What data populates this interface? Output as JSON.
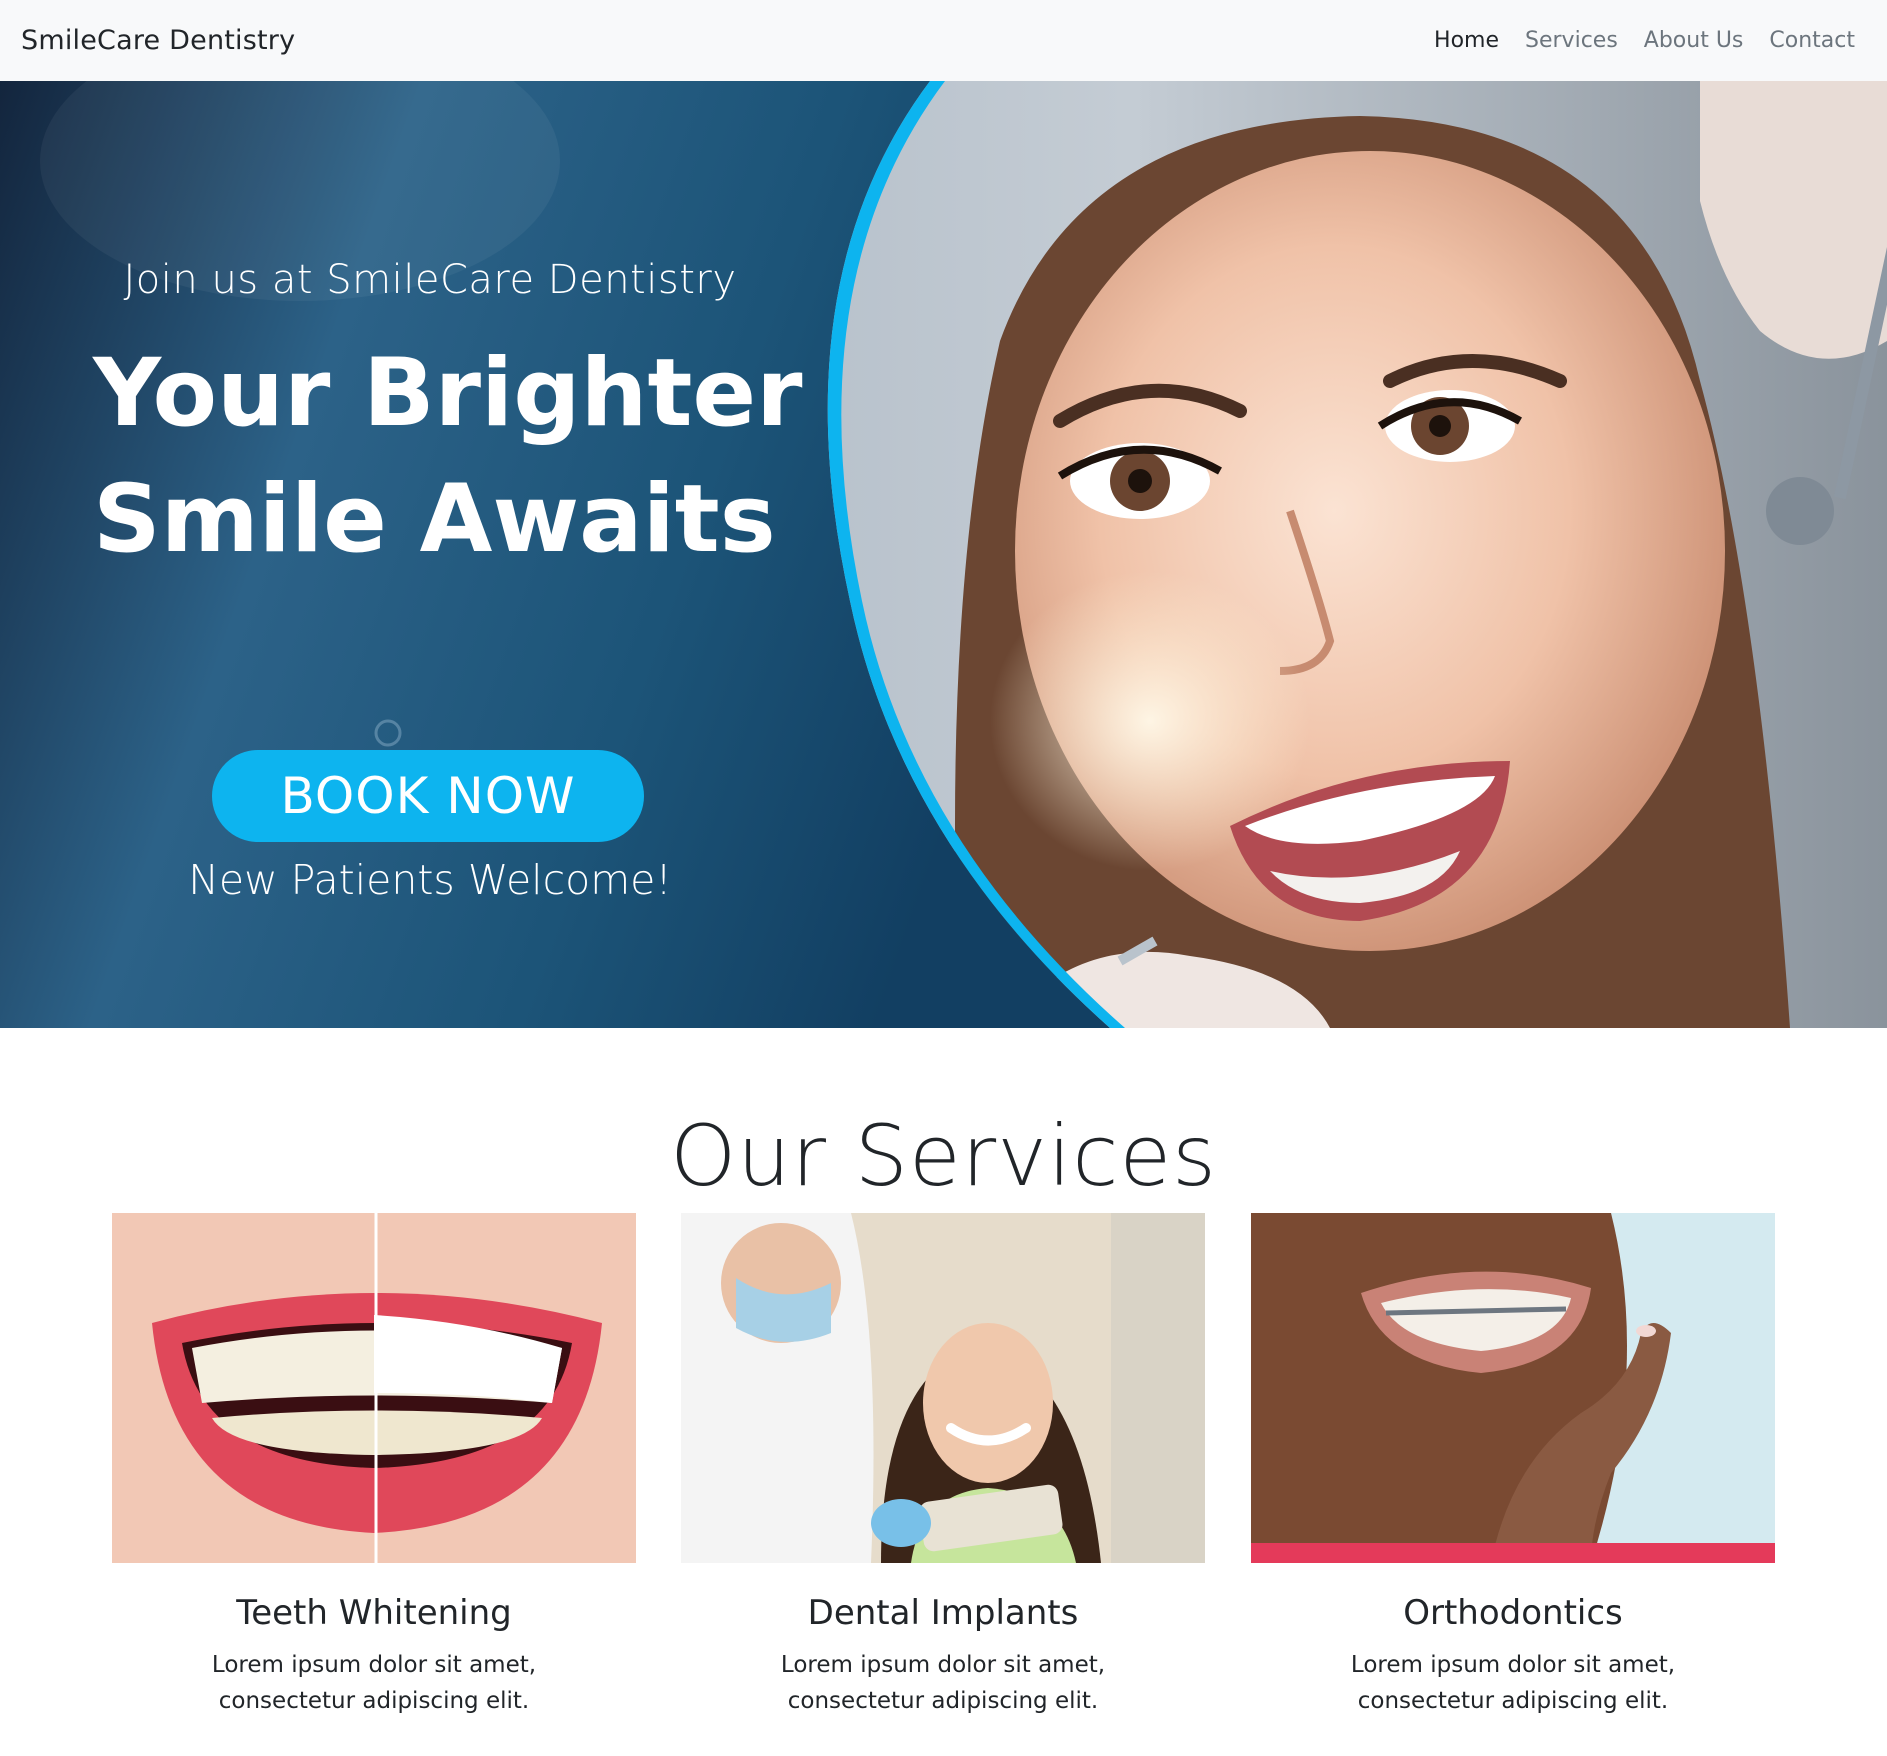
{
  "navbar": {
    "brand": "SmileCare Dentistry",
    "links": [
      {
        "label": "Home",
        "active": true
      },
      {
        "label": "Services",
        "active": false
      },
      {
        "label": "About Us",
        "active": false
      },
      {
        "label": "Contact",
        "active": false
      }
    ]
  },
  "hero": {
    "eyebrow": "Join us at SmileCare Dentistry",
    "title_line1": "Your Brighter",
    "title_line2": "Smile Awaits",
    "cta_label": "BOOK NOW",
    "subtitle": "New Patients Welcome!",
    "accent_color": "#0db4ef",
    "panel_color": "#1a4a70",
    "image_subject": "smiling woman patient in dental chair"
  },
  "services": {
    "title": "Our Services",
    "cards": [
      {
        "title": "Teeth Whitening",
        "text": "Lorem ipsum dolor sit amet, consectetur adipiscing elit.",
        "image_subject": "before-and-after smile teeth whitening"
      },
      {
        "title": "Dental Implants",
        "text": "Lorem ipsum dolor sit amet, consectetur adipiscing elit.",
        "image_subject": "dentist with patient holding shade guide"
      },
      {
        "title": "Orthodontics",
        "text": "Lorem ipsum dolor sit amet, consectetur adipiscing elit.",
        "image_subject": "smiling person with braces"
      }
    ]
  }
}
